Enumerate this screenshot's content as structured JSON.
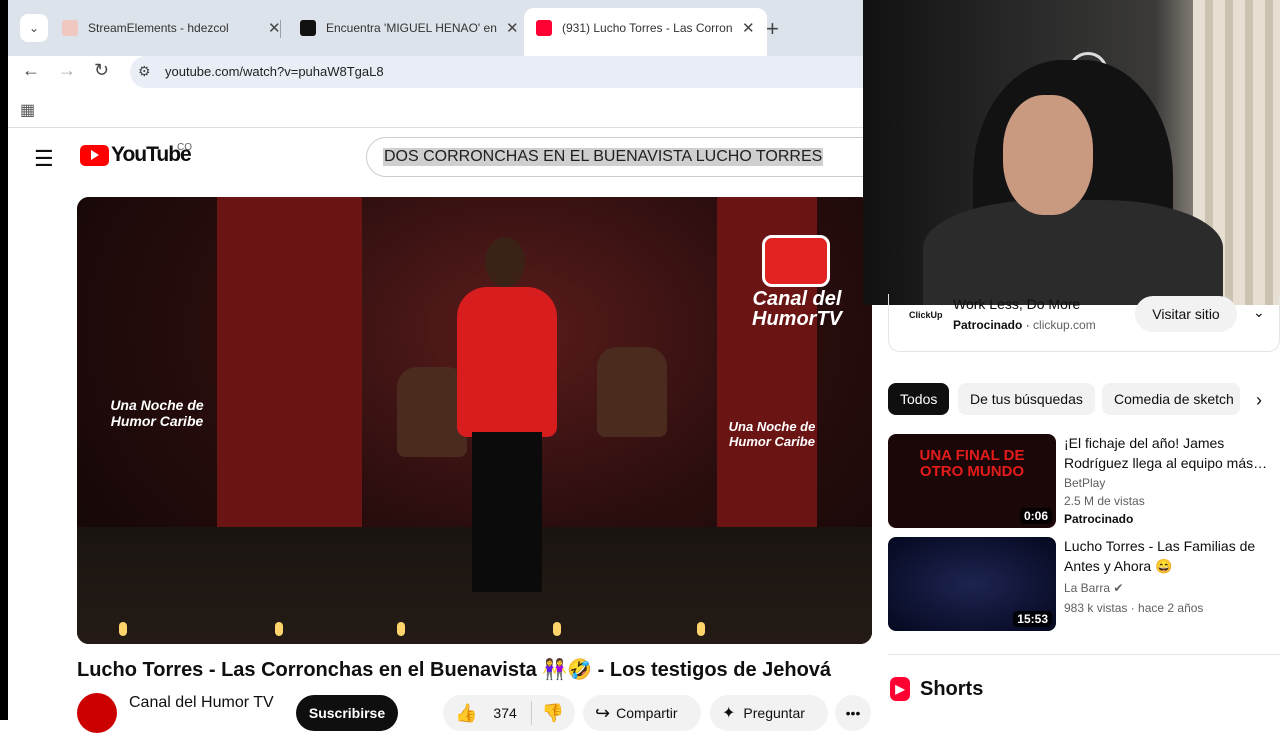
{
  "browser": {
    "tabs": [
      {
        "title": "StreamElements - hdezcol",
        "active": false
      },
      {
        "title": "Encuentra 'MIGUEL HENAO' en",
        "active": false
      },
      {
        "title": "(931) Lucho Torres - Las Corron",
        "active": true
      }
    ],
    "url": "youtube.com/watch?v=puhaW8TgaL8",
    "colors": {
      "tabbar": "#dde3ea",
      "omnibox": "#e9eef6"
    }
  },
  "youtube": {
    "logo_text": "YouTube",
    "country": "CO",
    "search_query": "DOS CORRONCHAS EN EL BUENAVISTA LUCHO TORRES",
    "brand_color": "#ff0000"
  },
  "video": {
    "watermark_top": "Canal del HumorTV",
    "stage_text_left": "Una Noche de Humor Caribe",
    "stage_text_right": "Una Noche de Humor Caribe",
    "title": "Lucho Torres - Las Corronchas en el Buenavista 👭🤣 - Los testigos de Jehová",
    "channel": "Canal del Humor TV",
    "subscribe_label": "Suscribirse",
    "likes": "374",
    "share_label": "Compartir",
    "ask_label": "Preguntar"
  },
  "ad": {
    "title": "Work Less, Do More",
    "advertiser": "ClickUp",
    "sponsored": "Patrocinado",
    "domain": "clickup.com",
    "visit_label": "Visitar sitio"
  },
  "chips": [
    "Todos",
    "De tus búsquedas",
    "Comedia de sketch"
  ],
  "recommendations": [
    {
      "title": "¡El fichaje del año! James Rodríguez llega al equipo más…",
      "channel": "BetPlay",
      "views": "2.5 M de vistas",
      "badge": "Patrocinado",
      "duration": "0:06",
      "thumb_text": "UNA FINAL DE OTRO MUNDO"
    },
    {
      "title": "Lucho Torres - Las Familias de Antes y Ahora 😄",
      "channel": "La Barra",
      "views": "983 k vistas",
      "age": "hace 2 años",
      "duration": "15:53"
    }
  ],
  "shorts_label": "Shorts"
}
